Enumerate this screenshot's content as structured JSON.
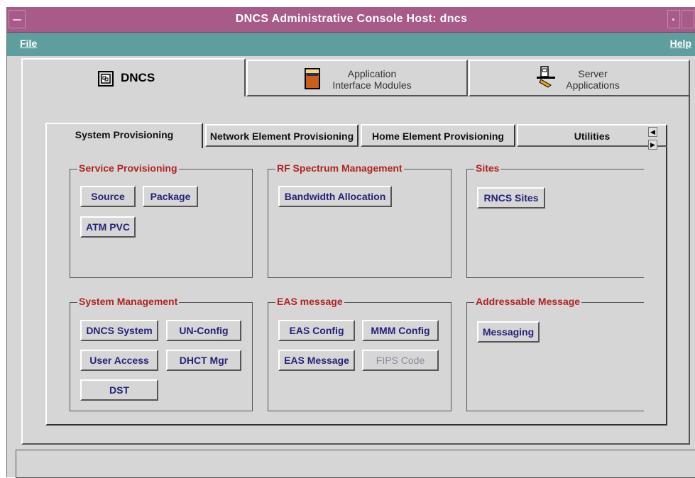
{
  "window": {
    "title": "DNCS Administrative Console   Host: dncs"
  },
  "menubar": {
    "file_label": "File",
    "help_label": "Help"
  },
  "outer_tabs": [
    {
      "label": "DNCS",
      "icon": "dncs-console-icon",
      "active": true
    },
    {
      "label_line1": "Application",
      "label_line2": "Interface Modules",
      "icon": "application-module-icon",
      "active": false
    },
    {
      "label_line1": "Server",
      "label_line2": "Applications",
      "icon": "server-applications-icon",
      "active": false
    }
  ],
  "inner_tabs": [
    {
      "label": "System Provisioning",
      "active": true
    },
    {
      "label": "Network Element Provisioning",
      "active": false
    },
    {
      "label": "Home Element Provisioning",
      "active": false
    },
    {
      "label": "Utilities",
      "active": false
    }
  ],
  "groups": {
    "service_provisioning": {
      "title": "Service Provisioning",
      "buttons": {
        "source": "Source",
        "package": "Package",
        "atm_pvc": "ATM PVC"
      }
    },
    "rf_spectrum": {
      "title": "RF Spectrum Management",
      "buttons": {
        "bandwidth": "Bandwidth Allocation"
      }
    },
    "sites": {
      "title": "Sites",
      "buttons": {
        "rncs_sites": "RNCS Sites"
      }
    },
    "system_management": {
      "title": "System Management",
      "buttons": {
        "dncs_system": "DNCS System",
        "un_config": "UN-Config",
        "user_access": "User Access",
        "dhct_mgr": "DHCT Mgr",
        "dst": "DST"
      }
    },
    "eas_message": {
      "title": "EAS message",
      "buttons": {
        "eas_config": "EAS Config",
        "mmm_config": "MMM Config",
        "eas_message": "EAS Message",
        "fips_code": "FIPS Code"
      }
    },
    "addressable_message": {
      "title": "Addressable Message",
      "buttons": {
        "messaging": "Messaging"
      }
    }
  },
  "colors": {
    "titlebar": "#a85a88",
    "menubar": "#5f9e9e",
    "window_bg": "#d6d6d6",
    "group_title": "#b22222",
    "button_text": "#23237a"
  }
}
